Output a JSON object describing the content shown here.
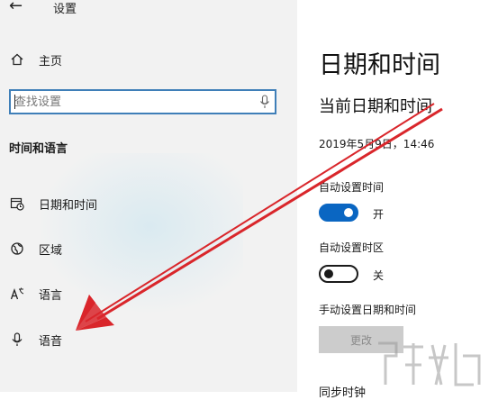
{
  "window": {
    "title": "设置"
  },
  "sidebar": {
    "home_label": "主页",
    "search_placeholder": "查找设置",
    "section_title": "时间和语言",
    "items": [
      {
        "label": "日期和时间",
        "icon": "calendar-clock-icon"
      },
      {
        "label": "区域",
        "icon": "globe-icon"
      },
      {
        "label": "语言",
        "icon": "language-icon"
      },
      {
        "label": "语音",
        "icon": "microphone-icon"
      }
    ]
  },
  "main": {
    "page_title": "日期和时间",
    "current_section": "当前日期和时间",
    "current_datetime": "2019年5月9日，14:46",
    "auto_time": {
      "label": "自动设置时间",
      "state": "开",
      "on": true
    },
    "auto_timezone": {
      "label": "自动设置时区",
      "state": "关",
      "on": false
    },
    "manual": {
      "label": "手动设置日期和时间",
      "button": "更改"
    },
    "sync_label": "同步时钟"
  },
  "colors": {
    "accent": "#0a66c2",
    "annotation_arrow": "#d9262b",
    "sidebar_bg": "#f2f2f2"
  }
}
